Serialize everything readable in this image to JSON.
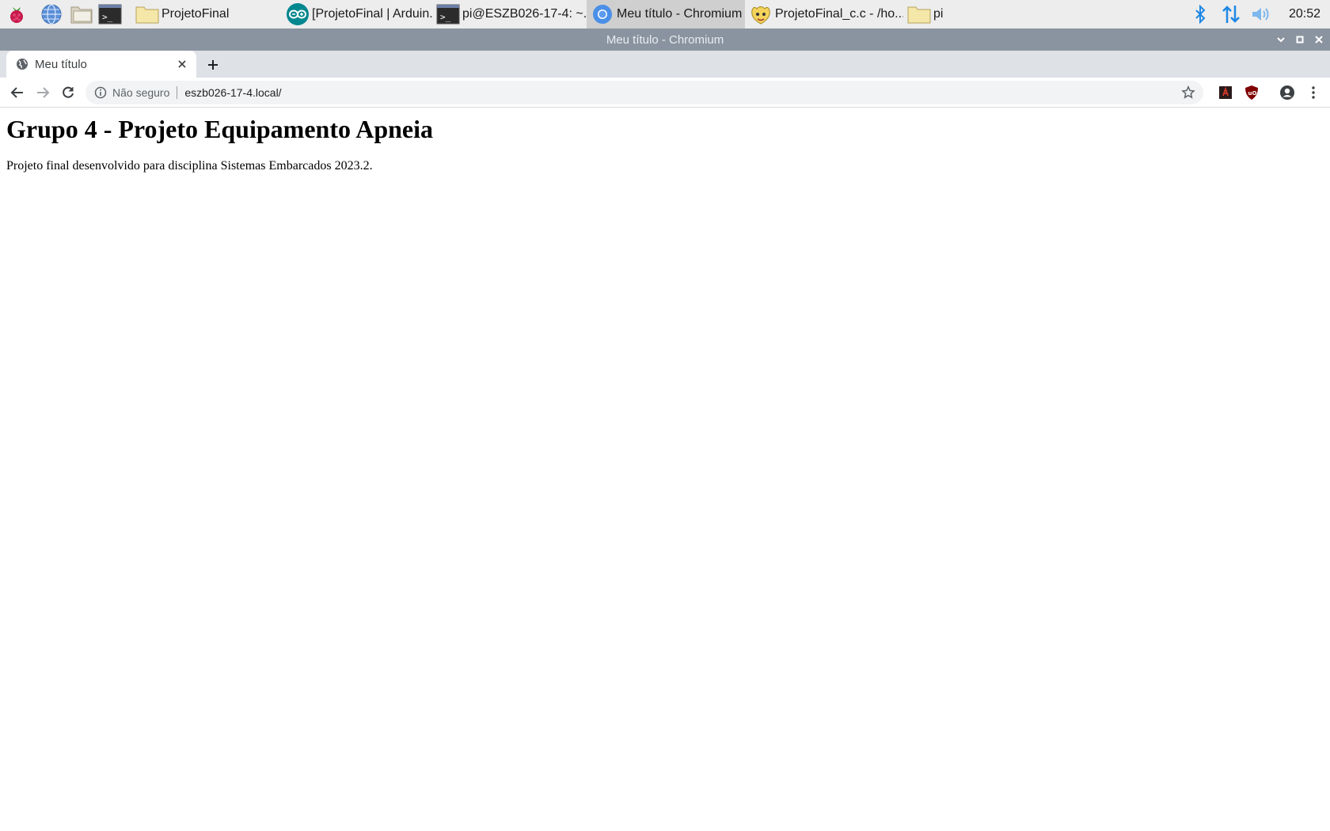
{
  "taskbar": {
    "launchers": [
      "raspberry-menu",
      "web-browser",
      "file-manager",
      "terminal"
    ],
    "tasks": [
      {
        "label": "ProjetoFinal",
        "icon": "folder-icon"
      },
      {
        "label": "[ProjetoFinal | Arduin...",
        "icon": "arduino-icon"
      },
      {
        "label": "pi@ESZB026-17-4: ~...",
        "icon": "terminal-icon"
      },
      {
        "label": "Meu título - Chromium",
        "icon": "chromium-icon",
        "active": true
      },
      {
        "label": "ProjetoFinal_c.c - /ho...",
        "icon": "geany-icon"
      },
      {
        "label": "pi",
        "icon": "folder-icon"
      }
    ],
    "tray": [
      "bluetooth-icon",
      "network-icon",
      "volume-icon"
    ],
    "clock": "20:52"
  },
  "window": {
    "title": "Meu título - Chromium"
  },
  "browser": {
    "tab": {
      "title": "Meu título"
    },
    "security_label": "Não seguro",
    "url": "eszb026-17-4.local/"
  },
  "page": {
    "heading": "Grupo 4 - Projeto Equipamento Apneia",
    "paragraph": "Projeto final desenvolvido para disciplina Sistemas Embarcados 2023.2."
  },
  "colors": {
    "titlebar": "#8a94a0",
    "taskbar": "#ededed",
    "tabstrip": "#dee1e6",
    "tray_blue": "#1e88e5"
  }
}
